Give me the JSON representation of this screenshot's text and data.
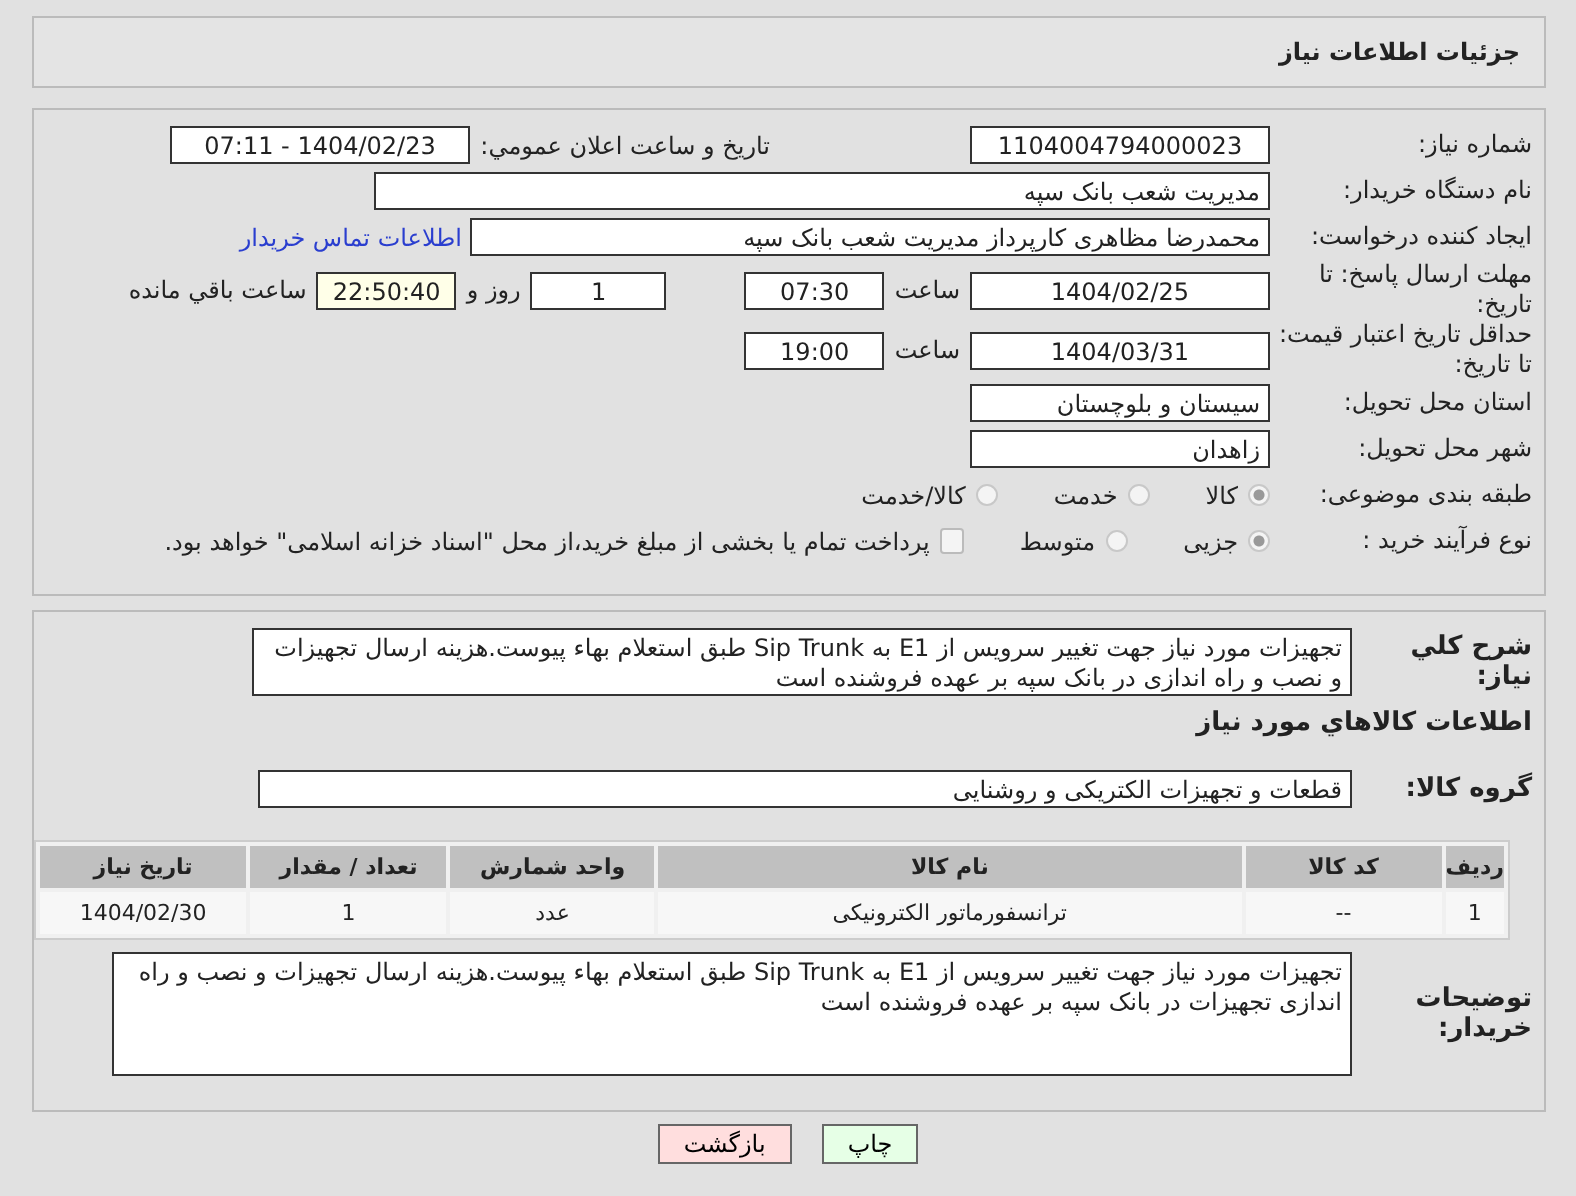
{
  "header": {
    "title": "جزئیات اطلاعات نیاز"
  },
  "need_number": {
    "label": "شماره نیاز:",
    "value": "1104004794000023"
  },
  "announce": {
    "label": "تاریخ و ساعت اعلان عمومي:",
    "value": "1404/02/23 - 07:11"
  },
  "buyer_org": {
    "label": "نام دستگاه خریدار:",
    "value": "مدیریت شعب بانک سپه"
  },
  "creator": {
    "label": "ایجاد کننده درخواست:",
    "value": "محمدرضا مظاهری کارپرداز مدیریت شعب بانک سپه",
    "link": "اطلاعات تماس خریدار"
  },
  "deadline": {
    "label": "مهلت ارسال پاسخ: تا تاریخ:",
    "date": "1404/02/25",
    "time_label": "ساعت",
    "time": "07:30",
    "days": "1",
    "days_label": "روز و",
    "remaining": "22:50:40",
    "remaining_label": "ساعت باقي مانده"
  },
  "validity": {
    "label": "حداقل تاریخ اعتبار قیمت: تا تاریخ:",
    "date": "1404/03/31",
    "time_label": "ساعت",
    "time": "19:00"
  },
  "province": {
    "label": "استان محل تحویل:",
    "value": "سیستان و بلوچستان"
  },
  "city": {
    "label": "شهر محل تحویل:",
    "value": "زاهدان"
  },
  "category": {
    "label": "طبقه بندی موضوعی:",
    "options": [
      {
        "label": "کالا",
        "selected": true
      },
      {
        "label": "خدمت",
        "selected": false
      },
      {
        "label": "کالا/خدمت",
        "selected": false
      }
    ]
  },
  "process": {
    "label": "نوع فرآیند خرید :",
    "options": [
      {
        "label": "جزیی",
        "selected": true
      },
      {
        "label": "متوسط",
        "selected": false
      }
    ],
    "treasury": {
      "label": "پرداخت تمام یا بخشی از مبلغ خرید،از محل \"اسناد خزانه اسلامی\" خواهد بود.",
      "checked": false
    }
  },
  "description": {
    "label": "شرح کلي نیاز:",
    "value": "تجهیزات مورد نیاز جهت تغییر سرویس از E1 به Sip Trunk  طبق استعلام بهاء پیوست.هزینه ارسال تجهیزات و نصب و راه اندازی در  بانک سپه بر عهده فروشنده است"
  },
  "goods": {
    "title": "اطلاعات كالاهاي مورد نياز",
    "group_label": "گروه کالا:",
    "group": "قطعات و تجهیزات الکتریکی و روشنایی",
    "columns": [
      "ردیف",
      "کد کالا",
      "نام کالا",
      "واحد شمارش",
      "تعداد / مقدار",
      "تاریخ نیاز"
    ],
    "rows": [
      [
        "1",
        "--",
        "ترانسفورماتور الکترونیکی",
        "عدد",
        "1",
        "1404/02/30"
      ]
    ]
  },
  "buyer_notes": {
    "label": "توضیحات خریدار:",
    "value": "تجهیزات مورد نیاز جهت تغییر سرویس از E1 به Sip Trunk  طبق استعلام بهاء پیوست.هزینه ارسال تجهیزات و نصب و راه اندازی تجهیزات در  بانک سپه بر عهده فروشنده است"
  },
  "buttons": [
    {
      "label": "چاپ",
      "kind": "print"
    },
    {
      "label": "بازگشت",
      "kind": "back"
    }
  ]
}
